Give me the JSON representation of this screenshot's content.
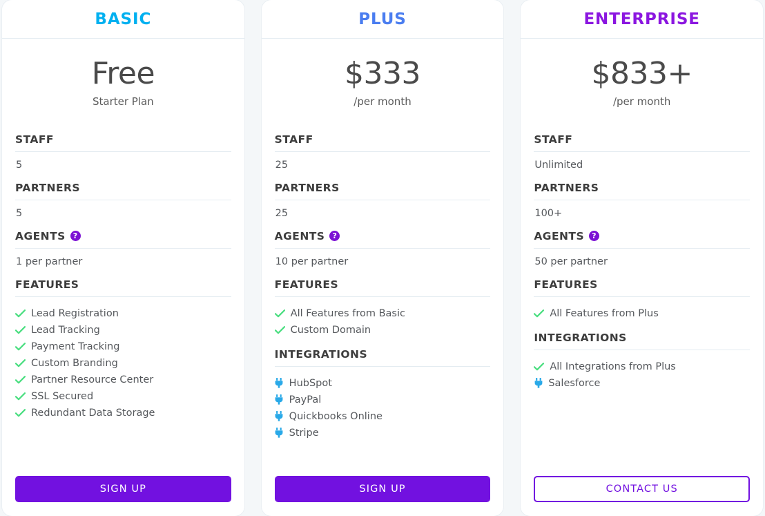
{
  "plans": [
    {
      "id": "basic",
      "name": "BASIC",
      "accent": "#00b0f0",
      "price": "Free",
      "period": "Starter Plan",
      "specs": [
        {
          "label": "STAFF",
          "help": false,
          "value": "5"
        },
        {
          "label": "PARTNERS",
          "help": false,
          "value": "5"
        },
        {
          "label": "AGENTS",
          "help": true,
          "help_glyph": "?",
          "value": "1 per partner"
        }
      ],
      "groups": [
        {
          "label": "FEATURES",
          "items": [
            {
              "icon": "check-icon",
              "text": "Lead Registration"
            },
            {
              "icon": "check-icon",
              "text": "Lead Tracking"
            },
            {
              "icon": "check-icon",
              "text": "Payment Tracking"
            },
            {
              "icon": "check-icon",
              "text": "Custom Branding"
            },
            {
              "icon": "check-icon",
              "text": "Partner Resource Center"
            },
            {
              "icon": "check-icon",
              "text": "SSL Secured"
            },
            {
              "icon": "check-icon",
              "text": "Redundant Data Storage"
            }
          ]
        }
      ],
      "cta": {
        "label": "SIGN UP",
        "style": "solid"
      }
    },
    {
      "id": "plus",
      "name": "PLUS",
      "accent": "#4a7df0",
      "price": "$333",
      "period": "/per month",
      "specs": [
        {
          "label": "STAFF",
          "help": false,
          "value": "25"
        },
        {
          "label": "PARTNERS",
          "help": false,
          "value": "25"
        },
        {
          "label": "AGENTS",
          "help": true,
          "help_glyph": "?",
          "value": "10 per partner"
        }
      ],
      "groups": [
        {
          "label": "FEATURES",
          "items": [
            {
              "icon": "check-icon",
              "text": "All Features from Basic"
            },
            {
              "icon": "check-icon",
              "text": "Custom Domain"
            }
          ]
        },
        {
          "label": "INTEGRATIONS",
          "items": [
            {
              "icon": "plug-icon",
              "text": "HubSpot"
            },
            {
              "icon": "plug-icon",
              "text": "PayPal"
            },
            {
              "icon": "plug-icon",
              "text": "Quickbooks Online"
            },
            {
              "icon": "plug-icon",
              "text": "Stripe"
            }
          ]
        }
      ],
      "cta": {
        "label": "SIGN UP",
        "style": "solid"
      }
    },
    {
      "id": "enterprise",
      "name": "ENTERPRISE",
      "accent": "#8b16e0",
      "price": "$833+",
      "period": "/per month",
      "specs": [
        {
          "label": "STAFF",
          "help": false,
          "value": "Unlimited"
        },
        {
          "label": "PARTNERS",
          "help": false,
          "value": "100+"
        },
        {
          "label": "AGENTS",
          "help": true,
          "help_glyph": "?",
          "value": "50 per partner"
        }
      ],
      "groups": [
        {
          "label": "FEATURES",
          "items": [
            {
              "icon": "check-icon",
              "text": "All Features from Plus"
            }
          ]
        },
        {
          "label": "INTEGRATIONS",
          "items": [
            {
              "icon": "check-icon",
              "text": "All Integrations from Plus"
            },
            {
              "icon": "plug-icon",
              "text": "Salesforce"
            }
          ]
        }
      ],
      "cta": {
        "label": "CONTACT US",
        "style": "outline"
      }
    }
  ],
  "colors": {
    "page_background": "#f4f7f9",
    "card_background": "#ffffff",
    "divider": "#e4ecf1",
    "check_green": "#4ade80",
    "plug_blue": "#29a9e8",
    "purple": "#7211e0",
    "help_badge": "#7b12d4",
    "text_primary": "#3d3d3d",
    "text_secondary": "#55585c",
    "price_text": "#4a4a4a"
  }
}
